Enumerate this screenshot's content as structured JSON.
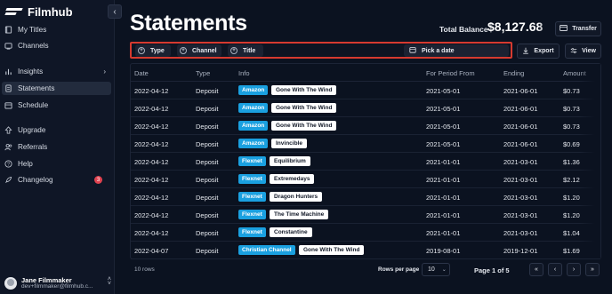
{
  "app": {
    "name": "Filmhub"
  },
  "sidebar": {
    "items": [
      {
        "label": "My Titles",
        "icon": "book-icon"
      },
      {
        "label": "Channels",
        "icon": "tv-icon"
      },
      {
        "label": "Insights",
        "icon": "chart-icon"
      },
      {
        "label": "Statements",
        "icon": "document-icon",
        "active": true
      },
      {
        "label": "Schedule",
        "icon": "calendar-icon"
      },
      {
        "label": "Upgrade",
        "icon": "upgrade-icon"
      },
      {
        "label": "Referrals",
        "icon": "users-icon"
      },
      {
        "label": "Help",
        "icon": "help-icon"
      },
      {
        "label": "Changelog",
        "icon": "rocket-icon",
        "badge": "3"
      }
    ],
    "user": {
      "name": "Jane Filmmaker",
      "email": "dev+filmmaker@filmhub.c..."
    }
  },
  "header": {
    "title": "Statements",
    "balance_label": "Total Balance",
    "balance_value": "$8,127.68",
    "transfer_label": "Transfer"
  },
  "filters": {
    "type_label": "Type",
    "channel_label": "Channel",
    "title_label": "Title",
    "date_label": "Pick a date",
    "export_label": "Export",
    "view_label": "View"
  },
  "table": {
    "columns": [
      "Date",
      "Type",
      "Info",
      "For Period From",
      "Ending",
      "Amount"
    ],
    "rows": [
      {
        "date": "2022-04-12",
        "type": "Deposit",
        "channel": "Amazon",
        "title": "Gone With The Wind",
        "from": "2021-05-01",
        "ending": "2021-06-01",
        "amount": "$0.73"
      },
      {
        "date": "2022-04-12",
        "type": "Deposit",
        "channel": "Amazon",
        "title": "Gone With The Wind",
        "from": "2021-05-01",
        "ending": "2021-06-01",
        "amount": "$0.73"
      },
      {
        "date": "2022-04-12",
        "type": "Deposit",
        "channel": "Amazon",
        "title": "Gone With The Wind",
        "from": "2021-05-01",
        "ending": "2021-06-01",
        "amount": "$0.73"
      },
      {
        "date": "2022-04-12",
        "type": "Deposit",
        "channel": "Amazon",
        "title": "Invincible",
        "from": "2021-05-01",
        "ending": "2021-06-01",
        "amount": "$0.69"
      },
      {
        "date": "2022-04-12",
        "type": "Deposit",
        "channel": "Flexnet",
        "title": "Equilibrium",
        "from": "2021-01-01",
        "ending": "2021-03-01",
        "amount": "$1.36"
      },
      {
        "date": "2022-04-12",
        "type": "Deposit",
        "channel": "Flexnet",
        "title": "Extremedays",
        "from": "2021-01-01",
        "ending": "2021-03-01",
        "amount": "$2.12"
      },
      {
        "date": "2022-04-12",
        "type": "Deposit",
        "channel": "Flexnet",
        "title": "Dragon Hunters",
        "from": "2021-01-01",
        "ending": "2021-03-01",
        "amount": "$1.20"
      },
      {
        "date": "2022-04-12",
        "type": "Deposit",
        "channel": "Flexnet",
        "title": "The Time Machine",
        "from": "2021-01-01",
        "ending": "2021-03-01",
        "amount": "$1.20"
      },
      {
        "date": "2022-04-12",
        "type": "Deposit",
        "channel": "Flexnet",
        "title": "Constantine",
        "from": "2021-01-01",
        "ending": "2021-03-01",
        "amount": "$1.04"
      },
      {
        "date": "2022-04-07",
        "type": "Deposit",
        "channel": "Christian Channel",
        "title": "Gone With The Wind",
        "from": "2019-08-01",
        "ending": "2019-12-01",
        "amount": "$1.69"
      }
    ]
  },
  "footer": {
    "rows_count": "10 rows",
    "rows_per_page_label": "Rows per page",
    "rows_per_page_value": "10",
    "page_label": "Page 1 of 5"
  },
  "colors": {
    "accent": "#1aa0e0",
    "highlight_border": "#d63a2f",
    "badge_red": "#e0424f"
  }
}
